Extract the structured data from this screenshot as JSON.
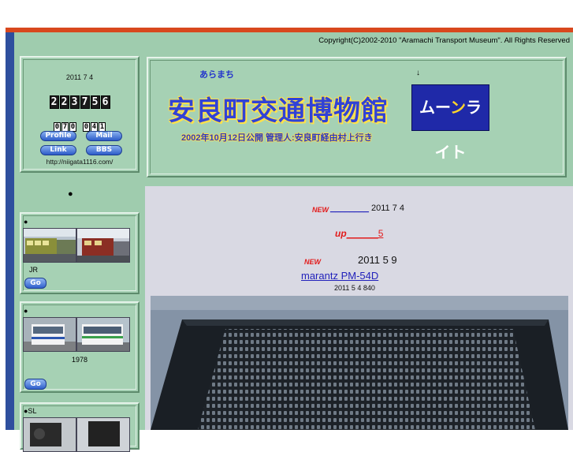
{
  "header": {
    "copyright": "Copyright(C)2002-2010 \"Aramachi Transport Museum\". All Rights Reserved"
  },
  "counter": {
    "date": "2011 7 4",
    "total": "223756",
    "today": "070",
    "yesterday": "041",
    "buttons": {
      "profile": "Profile",
      "mail": "Mail",
      "link": "Link",
      "bbs": "BBS"
    },
    "url": "http://niigata1116.com/"
  },
  "sidebar": {
    "bullet": "●",
    "sections": [
      {
        "heading": "●",
        "caption": "JR",
        "go_label": "Go"
      },
      {
        "heading": "●",
        "caption": "1978",
        "go_label": "Go"
      },
      {
        "heading": "●SL"
      }
    ]
  },
  "banner": {
    "kana": "あらまち",
    "arrow": "↓",
    "title": "安良町交通博物館",
    "subtitle": "2002年10月12日公開 管理人:安良町経由村上行き",
    "logo_text_left": "ム",
    "logo_text_mid": "ー",
    "logo_moon": "ン",
    "logo_text_right": "ライト"
  },
  "news": {
    "item1": {
      "badge": "NEW",
      "link_text": "________",
      "date": "2011 7 4"
    },
    "item2": {
      "link_prefix": "up",
      "link_suffix": "______5"
    },
    "item3": {
      "badge": "NEW",
      "date": "2011 5 9"
    },
    "item4": {
      "link_text": "marantz         PM-54D "
    },
    "item5": {
      "text": "2011 5 4    840"
    }
  },
  "colors": {
    "page_bg": "#9fccae",
    "accent_rule": "#d8481e",
    "left_rule": "#2e4f9e",
    "new_badge": "#e21b1b",
    "link": "#2222bb"
  }
}
